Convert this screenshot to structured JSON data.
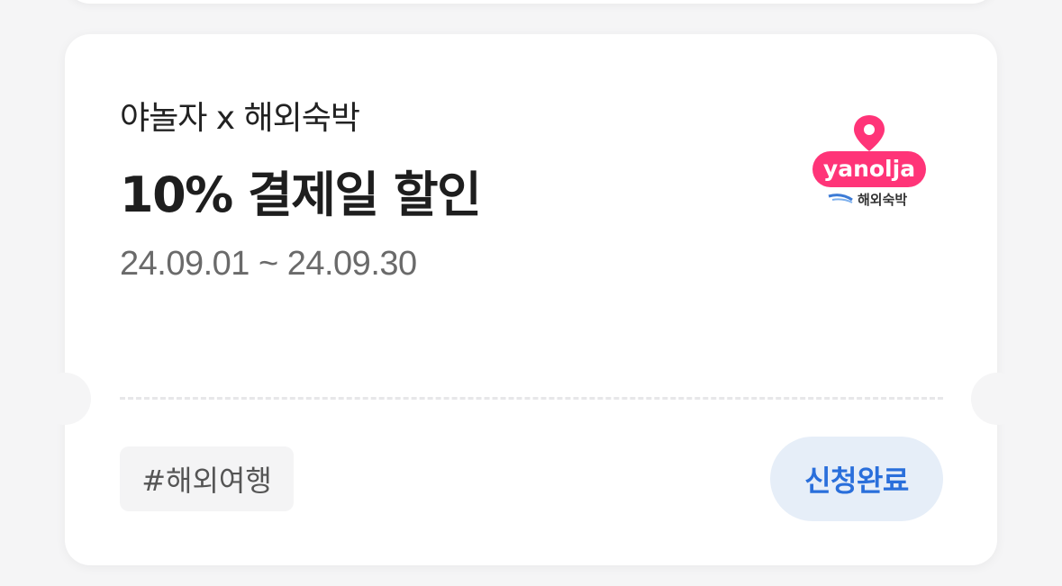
{
  "coupon": {
    "partner": "야놀자 x 해외숙박",
    "title": "10% 결제일 할인",
    "period": "24.09.01 ~ 24.09.30",
    "tag": "#해외여행",
    "button_label": "신청완료",
    "logo": {
      "icon": "location-pin-icon",
      "wordmark": "yanolja",
      "sub_label": "해외숙박",
      "brand_color": "#ff3478"
    }
  },
  "colors": {
    "background": "#f5f5f6",
    "card": "#ffffff",
    "button_bg": "#e6eef8",
    "button_text": "#2a6fdb"
  }
}
